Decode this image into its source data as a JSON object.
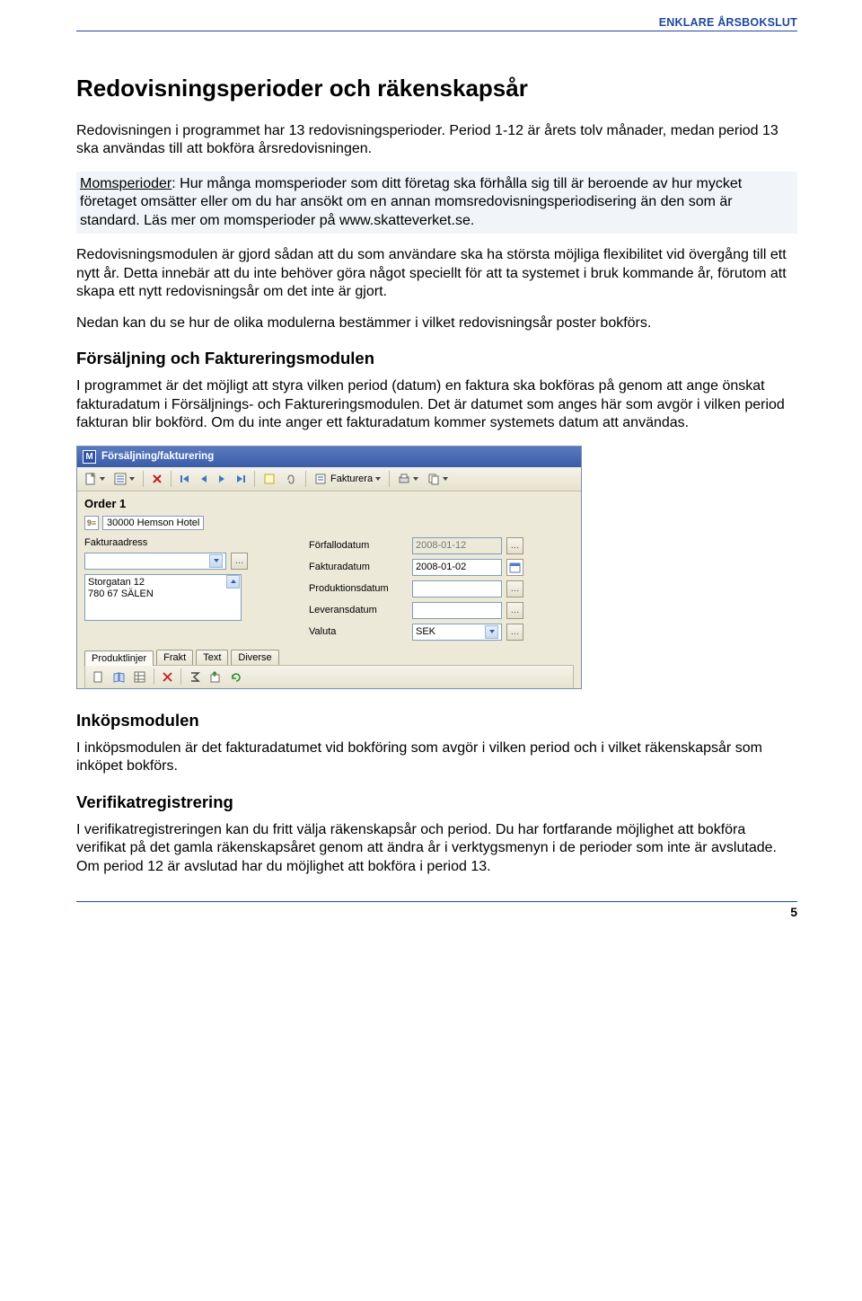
{
  "header": "ENKLARE ÅRSBOKSLUT",
  "h1": "Redovisningsperioder och räkenskapsår",
  "p1": "Redovisningen i programmet har 13 redovisningsperioder. Period 1-12 är årets tolv månader, medan period 13 ska användas till att bokföra årsredovisningen.",
  "callout_lead": "Momsperioder",
  "callout": ": Hur många momsperioder som ditt företag ska förhålla sig till är beroende av hur mycket företaget omsätter eller om du har ansökt om en annan momsredovisningsperiodisering än den som är standard. Läs mer om momsperioder på www.skatteverket.se.",
  "p2": "Redovisningsmodulen är gjord sådan att du som användare ska ha största möjliga flexibilitet vid övergång till ett nytt år. Detta innebär att du inte behöver göra något speciellt för att ta systemet i bruk kommande år, förutom att skapa ett nytt redovisningsår om det inte är gjort.",
  "p3": "Nedan kan du se hur de olika modulerna bestämmer i vilket redovisningsår poster bokförs.",
  "h2a": "Försäljning och Faktureringsmodulen",
  "p4": "I programmet är det möjligt att styra vilken period (datum) en faktura ska bokföras på genom att ange önskat fakturadatum i Försäljnings- och Faktureringsmodulen. Det är datumet som anges här som avgör i vilken period fakturan blir bokförd. Om du inte anger ett fakturadatum kommer systemets datum att användas.",
  "app": {
    "title": "Försäljning/fakturering",
    "fakturera": "Fakturera",
    "order": "Order 1",
    "customer": "30000 Hemson Hotel",
    "fakturaadress_label": "Fakturaadress",
    "address": "Storgatan 12\n780 67 SÄLEN",
    "fields": {
      "forfallodatum": {
        "label": "Förfallodatum",
        "value": "2008-01-12"
      },
      "fakturadatum": {
        "label": "Fakturadatum",
        "value": "2008-01-02"
      },
      "produktionsdatum": {
        "label": "Produktionsdatum",
        "value": ""
      },
      "leveransdatum": {
        "label": "Leveransdatum",
        "value": ""
      },
      "valuta": {
        "label": "Valuta",
        "value": "SEK"
      }
    },
    "tabs": [
      "Produktlinjer",
      "Frakt",
      "Text",
      "Diverse"
    ]
  },
  "h2b": "Inköpsmodulen",
  "p5": "I inköpsmodulen är det fakturadatumet vid bokföring som avgör i vilken period och i vilket räkenskapsår som inköpet bokförs.",
  "h2c": "Verifikatregistrering",
  "p6": "I verifikatregistreringen kan du fritt välja räkenskapsår och period. Du har fortfarande möjlighet att bokföra verifikat på det gamla räkenskapsåret genom att ändra år i verktygsmenyn i de perioder som inte är avslutade. Om period 12 är avslutad har du möjlighet att bokföra i period 13.",
  "page_num": "5"
}
